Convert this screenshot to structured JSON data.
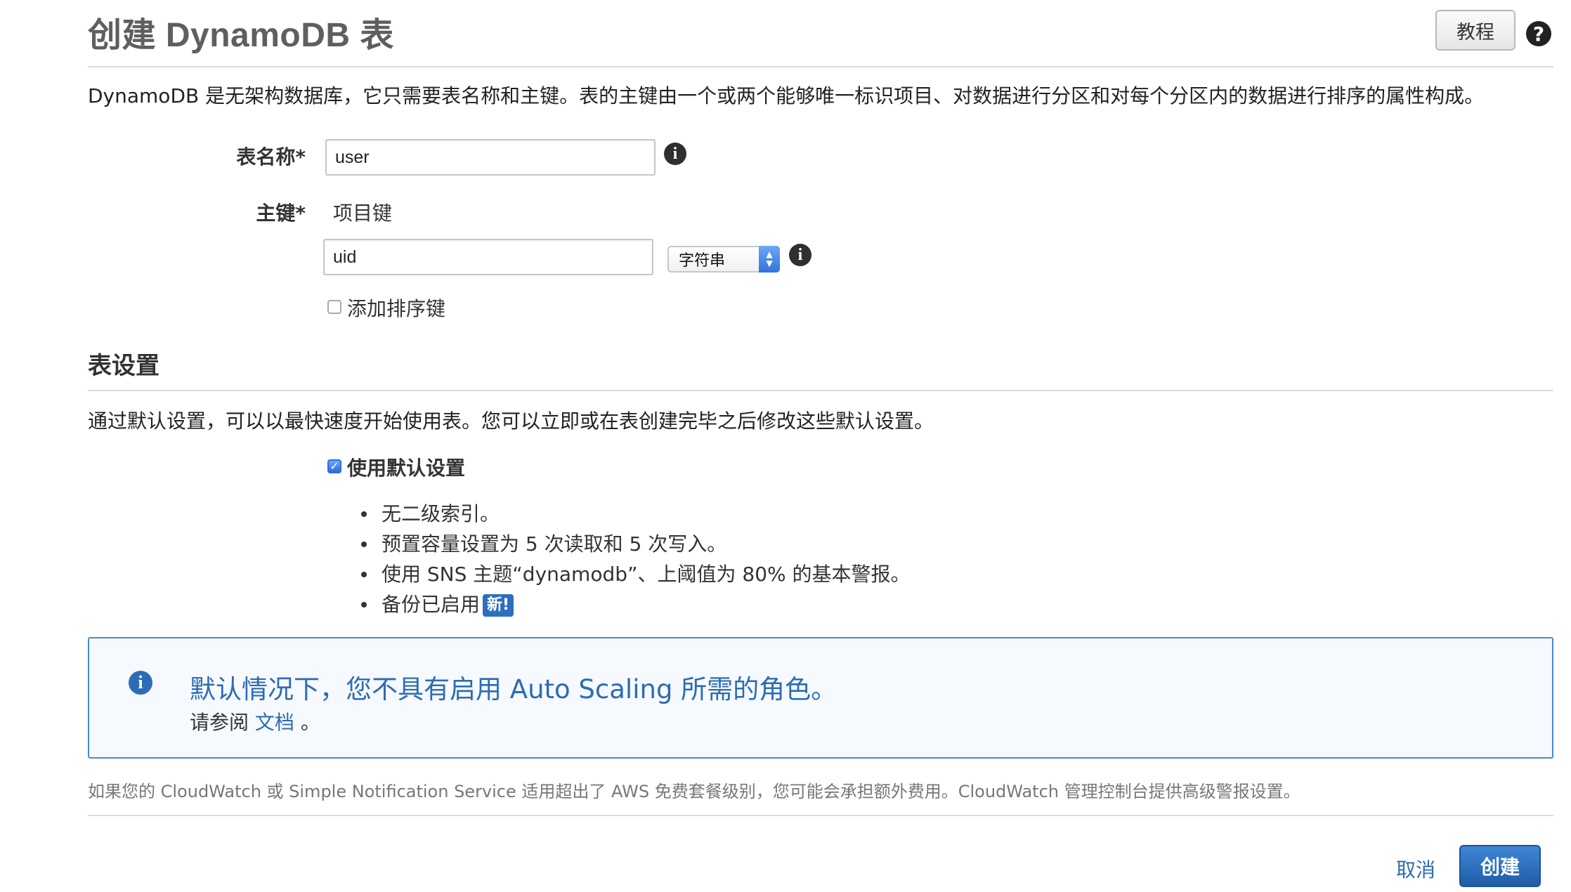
{
  "header": {
    "title": "创建 DynamoDB 表",
    "tutorial_label": "教程",
    "help_glyph": "?"
  },
  "intro": "DynamoDB 是无架构数据库，它只需要表名称和主键。表的主键由一个或两个能够唯一标识项目、对数据进行分区和对每个分区内的数据进行排序的属性构成。",
  "form": {
    "table_name_label": "表名称*",
    "table_name_value": "user",
    "primary_key_label": "主键*",
    "partition_key_caption": "项目键",
    "partition_key_value": "uid",
    "partition_key_type": "字符串",
    "add_sort_key_label": "添加排序键",
    "add_sort_key_checked": false,
    "info_glyph": "i"
  },
  "table_settings": {
    "title": "表设置",
    "description": "通过默认设置，可以以最快速度开始使用表。您可以立即或在表创建完毕之后修改这些默认设置。",
    "use_default_label": "使用默认设置",
    "use_default_checked": true,
    "defaults": [
      "无二级索引。",
      "预置容量设置为 5 次读取和 5 次写入。",
      "使用 SNS 主题“dynamodb”、上阈值为 80% 的基本警报。",
      "备份已启用"
    ],
    "new_badge": "新!"
  },
  "notice": {
    "title": "默认情况下，您不具有启用 Auto Scaling 所需的角色。",
    "prefix": "请参阅",
    "link": "文档",
    "suffix": "。"
  },
  "footnote": "如果您的 CloudWatch 或 Simple Notification Service 适用超出了 AWS 免费套餐级别，您可能会承担额外费用。CloudWatch 管理控制台提供高级警报设置。",
  "actions": {
    "cancel_label": "取消",
    "create_label": "创建"
  },
  "colors": {
    "accent": "#2b6cb5",
    "primary_button": "#1f5ea8",
    "info_border": "#4a89c8"
  },
  "icons": [
    "help-icon",
    "info-icon",
    "checkbox-icon",
    "select-arrows-icon"
  ]
}
